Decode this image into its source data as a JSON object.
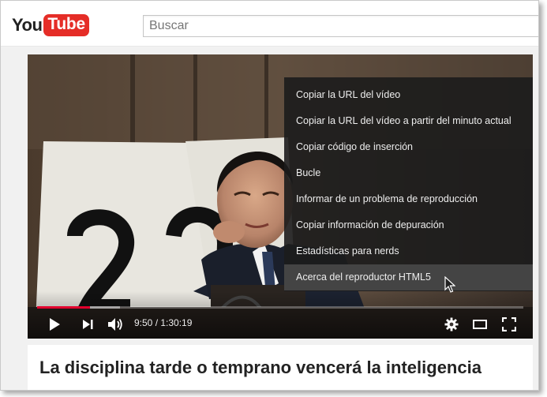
{
  "masthead": {
    "logo": {
      "you": "You",
      "tube": "Tube",
      "brand_color": "#e52d27"
    },
    "search": {
      "placeholder": "Buscar",
      "value": ""
    }
  },
  "player": {
    "context_menu": {
      "items": [
        {
          "label": "Copiar la URL del vídeo",
          "hovered": false
        },
        {
          "label": "Copiar la URL del vídeo a partir del minuto actual",
          "hovered": false
        },
        {
          "label": "Copiar código de inserción",
          "hovered": false
        },
        {
          "label": "Bucle",
          "hovered": false
        },
        {
          "label": "Informar de un problema de reproducción",
          "hovered": false
        },
        {
          "label": "Copiar información de depuración",
          "hovered": false
        },
        {
          "label": "Estadísticas para nerds",
          "hovered": false
        },
        {
          "label": "Acerca del reproductor HTML5",
          "hovered": true
        }
      ]
    },
    "controls": {
      "current_time": "9:50",
      "duration": "1:30:19",
      "time_display": "9:50 / 1:30:19",
      "progress_played_fraction": 0.109,
      "progress_loaded_fraction": 0.17,
      "icons": [
        "play-icon",
        "next-icon",
        "volume-icon",
        "settings-gear-icon",
        "theater-mode-icon",
        "fullscreen-icon"
      ],
      "accent_color": "#e1002d"
    }
  },
  "video": {
    "title": "La disciplina tarde o temprano vencerá la inteligencia"
  }
}
